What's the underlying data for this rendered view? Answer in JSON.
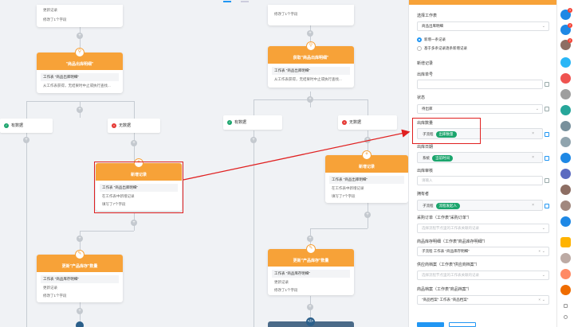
{
  "canvas": {
    "left_col": {
      "top_card_lines": [
        "更新记录",
        "修改了1个字段"
      ],
      "node1": {
        "title": "\"商品出库明细\"",
        "row": "工作表 \"商品出库明细\"",
        "desc": "从工作表获得，无结果时中止或执行查找..."
      },
      "branch_yes": "有数据",
      "branch_no": "无数据",
      "node2": {
        "title": "新增记录",
        "row": "工作表 \"商品出库明细\"",
        "desc1": "在工作表中新增记录",
        "desc2": "填写了7个字段"
      },
      "node3": {
        "title": "更新\"产品库存\"数量",
        "row": "工作表 \"商品库存明细\"",
        "desc1": "更新记录",
        "desc2": "修改了1个字段"
      }
    },
    "right_col": {
      "top_card_line": "修改了1个字段",
      "node1": {
        "title": "获取\"商品出库明细\"",
        "row": "工作表 \"商品出库明细\"",
        "desc": "从工作表获得，无结果时中止或执行查找..."
      },
      "branch_yes": "有数据",
      "branch_no": "无数据",
      "node2": {
        "title": "新增记录",
        "row": "工作表 \"商品出库明细\"",
        "desc1": "在工作表中新增记录",
        "desc2": "填写了7个字段"
      },
      "node3": {
        "title": "更新\"产品库存\"数量",
        "row": "工作表 \"商品库存明细\"",
        "desc1": "更新记录",
        "desc2": "修改了1个字段"
      }
    }
  },
  "panel": {
    "sheet_label": "选择工作表",
    "sheet_value": "商品出库明细",
    "radio1": "新增一条记录",
    "radio2": "基于多条记录逐条新增记录",
    "section_title": "新增记录",
    "f1_label": "出库单号",
    "f2_label": "状态",
    "f2_value": "待出库",
    "f3_label": "出库数量",
    "f3_chip_a": "子流程",
    "f3_chip_b": "出库数量",
    "f4_label": "出库日期",
    "f4_chip_a": "系统",
    "f4_chip_b": "当前时间",
    "f5_label": "出库审核",
    "f5_placeholder": "请输入",
    "f6_label": "拥有者",
    "f6_chip_a": "子流程",
    "f6_chip_b": "流程发起人",
    "f7_label": "采购订单（工作表\"采购订单\"）",
    "f7_placeholder": "选择流程节点里的工作表关联的记录",
    "f8_label": "商品库存明细（工作表\"商品库存明细\"）",
    "f8_chip": "子流程 工作表 \"商品库存明细\"",
    "f9_label": "供应商档案（工作表\"供应商档案\"）",
    "f9_placeholder": "选择流程节点里的工作表关联的记录",
    "f10_label": "商品档案（工作表\"商品档案\"）",
    "f10_chip": "\"商品档案\" 工作表 \"商品档案\""
  },
  "sidebar": {
    "badges": [
      "3",
      "2",
      "2"
    ]
  },
  "colors": {
    "node": "#f7a238",
    "accent": "#2196f3",
    "green": "#1ba56d",
    "red": "#e02020"
  }
}
